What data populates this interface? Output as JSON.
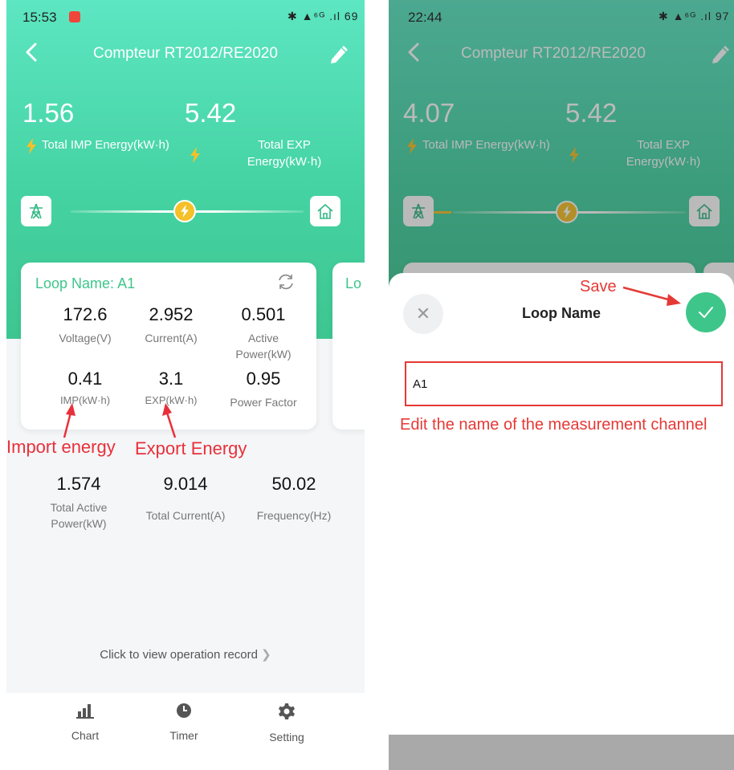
{
  "left_screen": {
    "status_time": "15:53",
    "status_icons": "✱ ▲⁶ᴳ .ıl 69",
    "title": "Compteur RT2012/RE2020",
    "imp_value": "1.56",
    "exp_value": "5.42",
    "imp_label": "Total IMP Energy(kW·h)",
    "exp_label": "Total EXP Energy(kW·h)",
    "loop_name": "Loop Name: A1",
    "next_card_peek": "Lo",
    "metrics": [
      {
        "value": "172.6",
        "label": "Voltage(V)"
      },
      {
        "value": "2.952",
        "label": "Current(A)"
      },
      {
        "value": "0.501",
        "label": "Active Power(kW)"
      },
      {
        "value": "0.41",
        "label": "IMP(kW·h)"
      },
      {
        "value": "3.1",
        "label": "EXP(kW·h)"
      },
      {
        "value": "0.95",
        "label": "Power Factor"
      }
    ],
    "annotation_import": "Import energy",
    "annotation_export": "Export Energy",
    "totals": [
      {
        "value": "1.574",
        "label": "Total Active Power(kW)"
      },
      {
        "value": "9.014",
        "label": "Total Current(A)"
      },
      {
        "value": "50.02",
        "label": "Frequency(Hz)"
      }
    ],
    "operation_link": "Click to view operation record",
    "tabs": [
      {
        "label": "Chart",
        "icon": "bar-chart-icon"
      },
      {
        "label": "Timer",
        "icon": "clock-icon"
      },
      {
        "label": "Setting",
        "icon": "gear-icon"
      }
    ],
    "colors": {
      "accent": "#45d3a3",
      "bolt": "#f5c028",
      "annotation": "#e8303a"
    }
  },
  "right_screen": {
    "status_time": "22:44",
    "status_icons": "✱ ▲⁶ᴳ .ıl 97",
    "title": "Compteur RT2012/RE2020",
    "imp_value": "4.07",
    "exp_value": "5.42",
    "imp_label": "Total IMP Energy(kW·h)",
    "exp_label": "Total EXP Energy(kW·h)",
    "dialog_title": "Loop Name",
    "input_value": "A1",
    "annotation_save": "Save",
    "annotation_edit": "Edit the name of the measurement channel",
    "colors": {
      "save": "#3ec68a",
      "annotation": "#e53935"
    }
  }
}
